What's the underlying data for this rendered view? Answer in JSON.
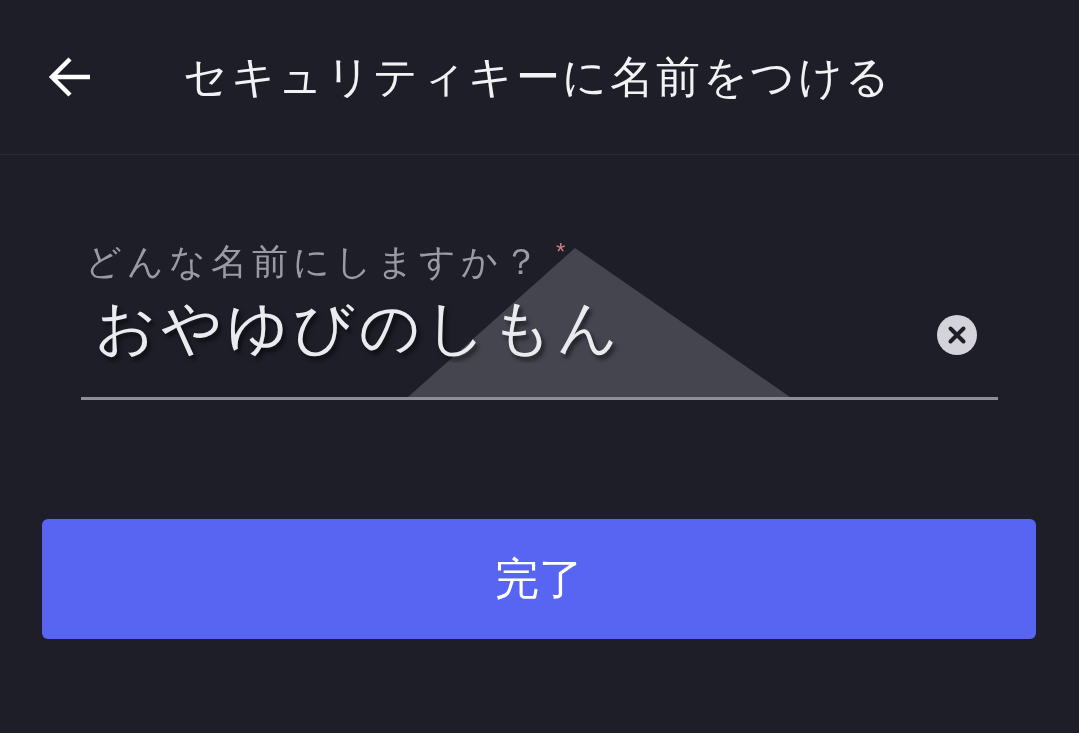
{
  "header": {
    "title": "セキュリティキーに名前をつける"
  },
  "form": {
    "label": "どんな名前にしますか？",
    "required_mark": "*",
    "value": "おやゆびのしもん"
  },
  "button": {
    "label": "完了"
  }
}
